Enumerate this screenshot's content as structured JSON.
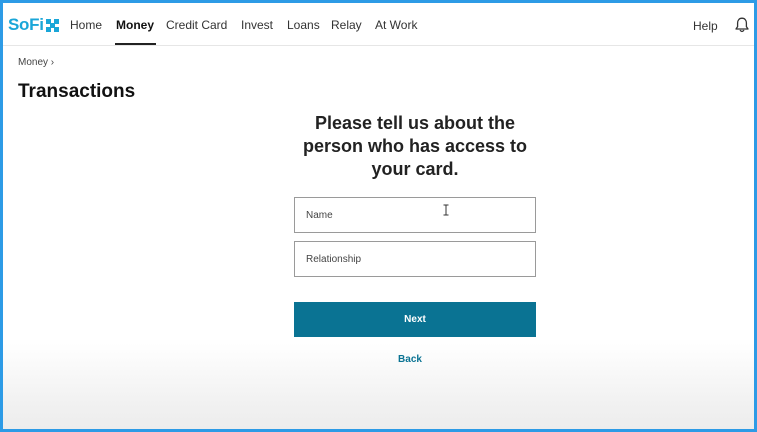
{
  "brand": {
    "logo_text": "SoFi",
    "accent_color": "#1aa6d8",
    "frame_color": "#2d9be6"
  },
  "nav": {
    "items": [
      {
        "label": "Home"
      },
      {
        "label": "Money"
      },
      {
        "label": "Credit Card"
      },
      {
        "label": "Invest"
      },
      {
        "label": "Loans"
      },
      {
        "label": "Relay"
      },
      {
        "label": "At Work"
      }
    ],
    "active": "Money",
    "help_label": "Help",
    "notification_icon": "bell-icon"
  },
  "breadcrumb": {
    "label": "Money",
    "separator": "›"
  },
  "page": {
    "title": "Transactions"
  },
  "form": {
    "prompt_line1": "Please tell us about the",
    "prompt_line2": "person who has access to",
    "prompt_line3": "your card.",
    "name_placeholder": "Name",
    "relationship_placeholder": "Relationship",
    "next_label": "Next",
    "back_label": "Back",
    "button_color": "#0a7393"
  }
}
